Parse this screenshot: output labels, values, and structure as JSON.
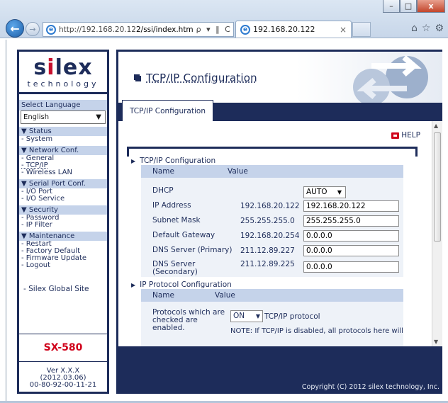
{
  "browser": {
    "url_prefix": "http://192.168.20.12",
    "url_rest": "2/ssi/index.htm",
    "url_tools": "ρ ▾ ‖ C ×",
    "tab_title": "192.168.20.122",
    "tab_close": "×",
    "min": "–",
    "max": "□",
    "close": "x"
  },
  "sidebar": {
    "logo_main": "silex",
    "logo_sub": "technology",
    "language_label": "Select Language",
    "language_value": "English",
    "sections": [
      {
        "title": "▼ Status",
        "items": [
          "- System"
        ]
      },
      {
        "title": "▼ Network Conf.",
        "items": [
          "- General",
          "- TCP/IP",
          "- Wireless LAN"
        ]
      },
      {
        "title": "▼ Serial Port Conf.",
        "items": [
          "- I/O Port",
          "- I/O Service"
        ]
      },
      {
        "title": "▼ Security",
        "items": [
          "- Password",
          "- IP Filter"
        ]
      },
      {
        "title": "▼ Maintenance",
        "items": [
          "- Restart",
          "- Factory Default",
          "- Firmware Update",
          "- Logout"
        ]
      }
    ],
    "global_site": "- Silex Global Site",
    "model": "SX-580",
    "version": "Ver X.X.X",
    "date": "(2012.03.06)",
    "mac": "00-80-92-00-11-21"
  },
  "main": {
    "title": "TCP/IP Configuration",
    "tab": "TCP/IP Configuration",
    "help": "HELP",
    "tcpip": {
      "section_title": "TCP/IP Configuration",
      "col_name": "Name",
      "col_value": "Value",
      "dhcp_label": "DHCP",
      "dhcp_value": "AUTO",
      "ip_label": "IP Address",
      "ip_current": "192.168.20.122",
      "ip_input": "192.168.20.122",
      "mask_label": "Subnet Mask",
      "mask_current": "255.255.255.0",
      "mask_input": "255.255.255.0",
      "gw_label": "Default Gateway",
      "gw_current": "192.168.20.254",
      "gw_input": "0.0.0.0",
      "dns1_label": "DNS Server (Primary)",
      "dns1_current": "211.12.89.227",
      "dns1_input": "0.0.0.0",
      "dns2_label_1": "DNS Server",
      "dns2_label_2": "(Secondary)",
      "dns2_current": "211.12.89.225",
      "dns2_input": "0.0.0.0"
    },
    "protocol": {
      "section_title": "IP Protocol Configuration",
      "col_name": "Name",
      "col_value": "Value",
      "label_1": "Protocols which are",
      "label_2": "checked are",
      "label_3": "enabled.",
      "select_value": "ON",
      "select_suffix": "TCP/IP protocol",
      "note": "NOTE: If TCP/IP is disabled, all protocols here will"
    },
    "copyright": "Copyright (C) 2012 silex technology, Inc."
  }
}
